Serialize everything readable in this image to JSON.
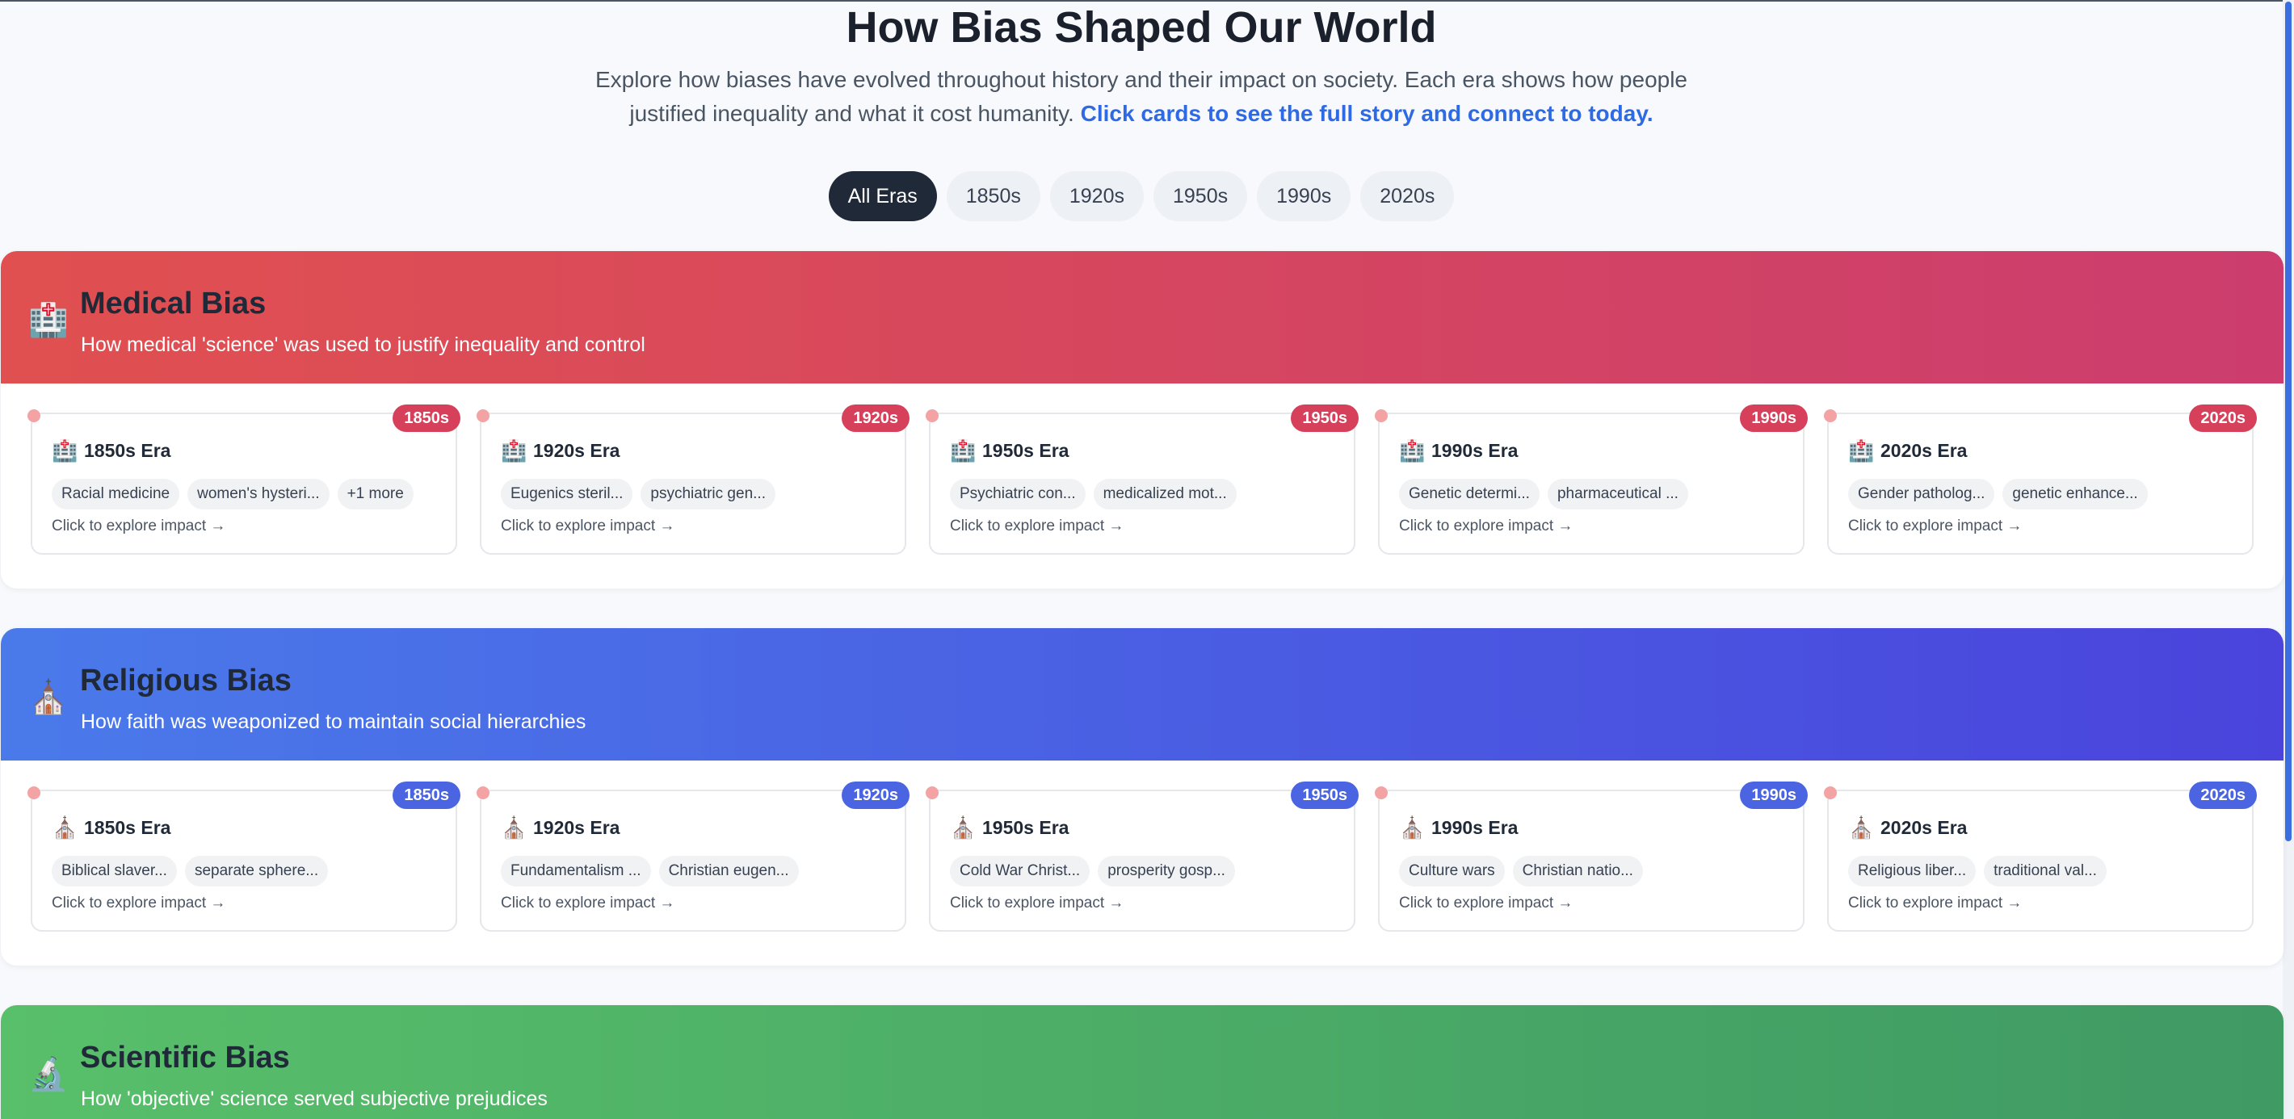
{
  "header": {
    "title": "How Bias Shaped Our World",
    "subtitle": "Explore how biases have evolved throughout history and their impact on society. Each era shows how people justified inequality and what it cost humanity.",
    "cta": "Click cards to see the full story and connect to today."
  },
  "filters": [
    "All Eras",
    "1850s",
    "1920s",
    "1950s",
    "1990s",
    "2020s"
  ],
  "active_filter": "All Eras",
  "colors": {
    "medical_gradient": [
      "#e05050",
      "#cc3d6e"
    ],
    "religious_gradient": [
      "#4a7aea",
      "#4a44dc"
    ],
    "scientific_gradient": [
      "#58bf6a",
      "#3f9a64"
    ],
    "medical_badge": "#d6405a",
    "religious_badge": "#4a64e2",
    "active_filter_bg": "#1f2937",
    "cta_text": "#2f6ae5"
  },
  "sections": [
    {
      "icon": "🏥",
      "icon_name": "hospital-icon",
      "title": "Medical Bias",
      "description": "How medical 'science' was used to justify inequality and control",
      "cards": [
        {
          "badge": "1850s",
          "title": "1850s Era",
          "tags": [
            "Racial medicine",
            "women's hysteri...",
            "+1 more"
          ],
          "cta": "Click to explore impact →"
        },
        {
          "badge": "1920s",
          "title": "1920s Era",
          "tags": [
            "Eugenics steril...",
            "psychiatric gen..."
          ],
          "cta": "Click to explore impact →"
        },
        {
          "badge": "1950s",
          "title": "1950s Era",
          "tags": [
            "Psychiatric con...",
            "medicalized mot..."
          ],
          "cta": "Click to explore impact →"
        },
        {
          "badge": "1990s",
          "title": "1990s Era",
          "tags": [
            "Genetic determi...",
            "pharmaceutical ..."
          ],
          "cta": "Click to explore impact →"
        },
        {
          "badge": "2020s",
          "title": "2020s Era",
          "tags": [
            "Gender patholog...",
            "genetic enhance..."
          ],
          "cta": "Click to explore impact →"
        }
      ]
    },
    {
      "icon": "⛪",
      "icon_name": "church-icon",
      "title": "Religious Bias",
      "description": "How faith was weaponized to maintain social hierarchies",
      "cards": [
        {
          "badge": "1850s",
          "title": "1850s Era",
          "tags": [
            "Biblical slaver...",
            "separate sphere..."
          ],
          "cta": "Click to explore impact →"
        },
        {
          "badge": "1920s",
          "title": "1920s Era",
          "tags": [
            "Fundamentalism ...",
            "Christian eugen..."
          ],
          "cta": "Click to explore impact →"
        },
        {
          "badge": "1950s",
          "title": "1950s Era",
          "tags": [
            "Cold War Christ...",
            "prosperity gosp..."
          ],
          "cta": "Click to explore impact →"
        },
        {
          "badge": "1990s",
          "title": "1990s Era",
          "tags": [
            "Culture wars",
            "Christian natio..."
          ],
          "cta": "Click to explore impact →"
        },
        {
          "badge": "2020s",
          "title": "2020s Era",
          "tags": [
            "Religious liber...",
            "traditional val..."
          ],
          "cta": "Click to explore impact →"
        }
      ]
    },
    {
      "icon": "🔬",
      "icon_name": "microscope-icon",
      "title": "Scientific Bias",
      "description": "How 'objective' science served subjective prejudices",
      "cards": []
    }
  ]
}
